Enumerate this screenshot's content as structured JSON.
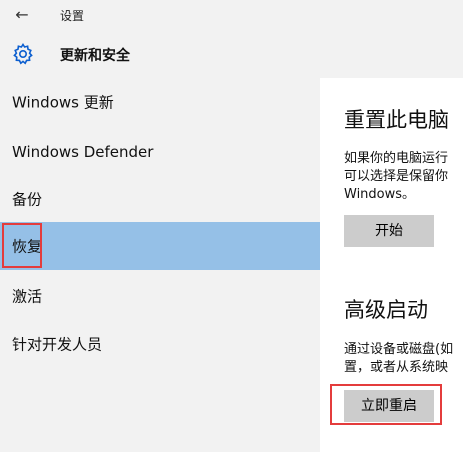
{
  "window": {
    "title": "设置",
    "back_icon": "back-arrow-icon",
    "back_glyph": "←"
  },
  "header": {
    "icon": "gear-icon",
    "title": "更新和安全"
  },
  "sidebar": {
    "items": [
      {
        "label": "Windows 更新"
      },
      {
        "label": "Windows Defender"
      },
      {
        "label": "备份"
      },
      {
        "label": "恢复",
        "selected": true
      },
      {
        "label": "激活"
      },
      {
        "label": "针对开发人员"
      }
    ]
  },
  "main": {
    "reset": {
      "title": "重置此电脑",
      "desc_line1": "如果你的电脑运行",
      "desc_line2": "可以选择是保留你",
      "desc_line3": "Windows。",
      "button": "开始"
    },
    "advanced": {
      "title": "高级启动",
      "desc_line1": "通过设备或磁盘(如",
      "desc_line2": "置，或者从系统映",
      "button": "立即重启"
    }
  },
  "colors": {
    "selected_bg": "#95c0e7",
    "highlight": "#e43c3c",
    "button_bg": "#cccccc",
    "gear": "#0b5ecf"
  }
}
